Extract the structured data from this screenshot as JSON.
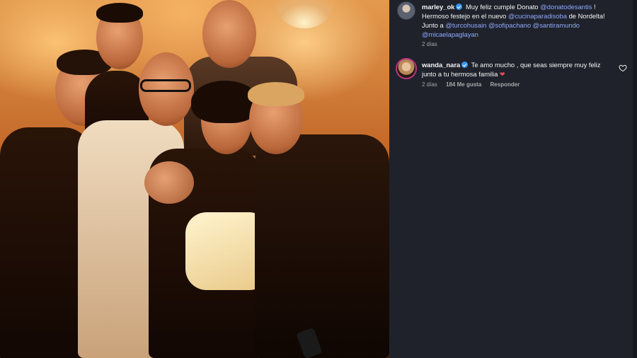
{
  "post": {
    "photo_alt": "Group photo"
  },
  "caption": {
    "username": "marley_ok",
    "text_1": "Muy feliz cumple Donato",
    "mention_1": "@donatodesantis",
    "text_2": " !",
    "text_3": "Hermoso festejo en el nuevo",
    "mention_2": "@cucinaparadisoba",
    "text_4": " de Nordelta!",
    "text_5": "Junto a",
    "mention_3": "@turcohusain",
    "mention_4": "@sofipachano",
    "mention_5": "@santiramundo",
    "mention_6": "@micaelapaglayan",
    "time": "2 días"
  },
  "comment": {
    "username": "wanda_nara",
    "text_1": "Te amo mucho , que seas siempre muy feliz",
    "text_2": "junto a tu hermosa familia",
    "heart": "❤",
    "time": "2 días",
    "likes": "184 Me gusta",
    "reply": "Responder"
  },
  "icons": {
    "verified": "verified-badge-icon",
    "like": "heart-outline-icon"
  },
  "colors": {
    "panel_bg": "#1f222b",
    "mention": "#8fa8ff",
    "verified": "#3897f0",
    "heart": "#ed4956"
  }
}
